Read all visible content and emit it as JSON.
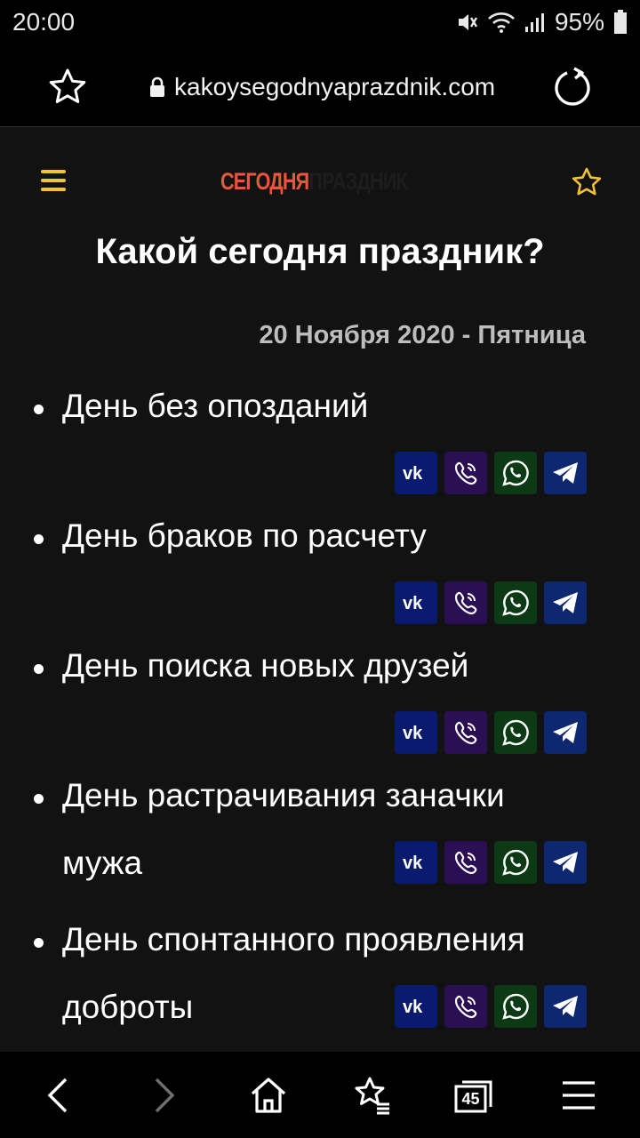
{
  "status": {
    "time": "20:00",
    "battery": "95%"
  },
  "browser": {
    "url": "kakoysegodnyaprazdnik.com",
    "tabs_count": "45"
  },
  "site": {
    "logo_part1": "СЕГОДНЯ",
    "logo_part2": "ПРАЗДНИК",
    "title": "Какой сегодня праздник?",
    "date": "20 Ноября 2020 - Пятница"
  },
  "holidays": [
    {
      "line1": "День без опозданий",
      "line2": ""
    },
    {
      "line1": "День браков по расчету",
      "line2": ""
    },
    {
      "line1": "День поиска новых друзей",
      "line2": ""
    },
    {
      "line1": "День растрачивания заначки",
      "line2": "мужа"
    },
    {
      "line1": "День спонтанного проявления",
      "line2": "доброты"
    }
  ],
  "share_icons": [
    "vk-icon",
    "viber-icon",
    "whatsapp-icon",
    "telegram-icon"
  ],
  "colors": {
    "accent_yellow": "#f2c230",
    "logo_red": "#e8573c",
    "vk_bg": "#0a1a6e",
    "viber_bg": "#2a0f54",
    "whatsapp_bg": "#0b3a14",
    "telegram_bg": "#0d2770"
  }
}
